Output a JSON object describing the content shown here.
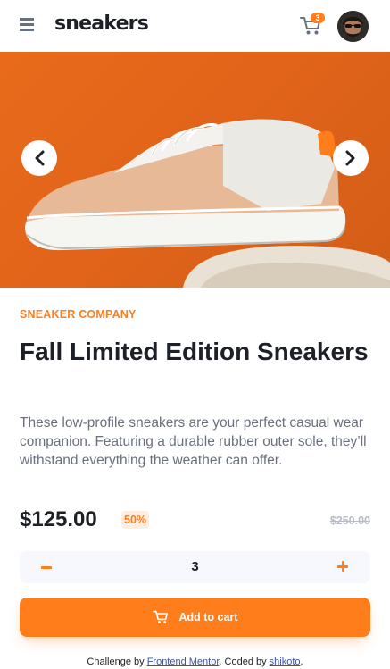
{
  "header": {
    "logo": "sneakers",
    "cart_count": "3",
    "icons": {
      "menu": "menu-icon",
      "cart": "cart-icon",
      "avatar": "avatar"
    }
  },
  "gallery": {
    "prev_icon": "chevron-left-icon",
    "next_icon": "chevron-right-icon"
  },
  "product": {
    "company": "SNEAKER COMPANY",
    "title": "Fall Limited Edition Sneakers",
    "description": "These low-profile sneakers are your perfect casual wear companion. Featuring a durable rubber outer sole, they’ll withstand everything the weather can offer.",
    "price": "$125.00",
    "discount": "50%",
    "original_price": "$250.00"
  },
  "quantity": {
    "value": "3"
  },
  "actions": {
    "add_to_cart": "Add to cart"
  },
  "attribution": {
    "prefix": "Challenge by ",
    "challenge_link": "Frontend Mentor",
    "middle": ". Coded by ",
    "author_link": "shikoto",
    "suffix": "."
  },
  "colors": {
    "accent": "#ff7d1a",
    "accent_pale": "#ffede0",
    "text_dark": "#1d2026",
    "text_grey": "#69707d",
    "text_light": "#b6bcc8",
    "qty_bg": "#f6f8fd"
  }
}
